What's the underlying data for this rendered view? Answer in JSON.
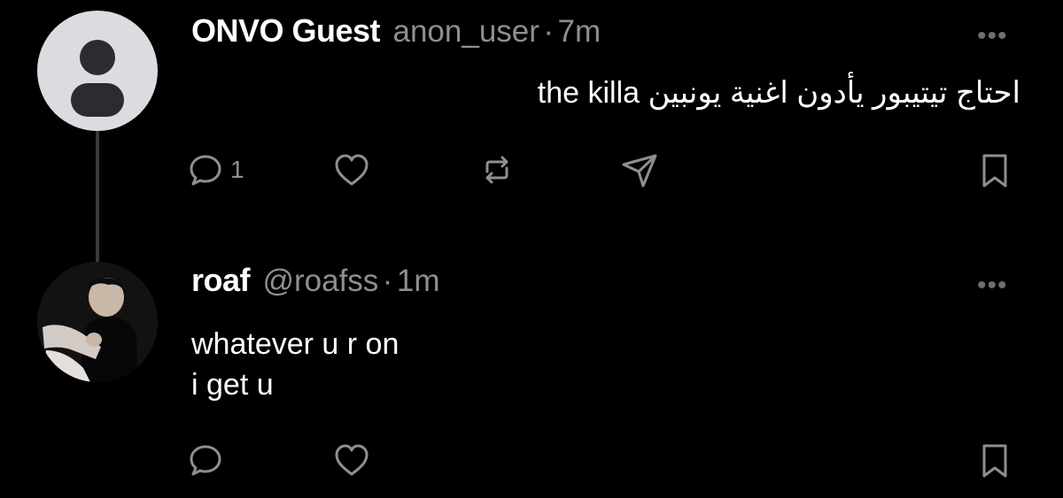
{
  "posts": [
    {
      "display_name": "ONVO Guest",
      "handle": "anon_user",
      "separator": "·",
      "time": "7m",
      "more": "•••",
      "body_lines": [
        "احتاج تيتيبور يأدون اغنية يونبين  the killa"
      ],
      "reply_count": "1",
      "avatar_icon": "default-profile-icon"
    },
    {
      "display_name": "roaf",
      "handle": "@roafss",
      "separator": "·",
      "time": "1m",
      "more": "•••",
      "body_lines": [
        "whatever u r on",
        "i get u"
      ],
      "avatar_icon": "profile-photo"
    }
  ],
  "colors": {
    "background": "#000000",
    "muted": "#8e8e93",
    "icon": "#8e8e93",
    "thread_line": "#3a3a3c"
  }
}
